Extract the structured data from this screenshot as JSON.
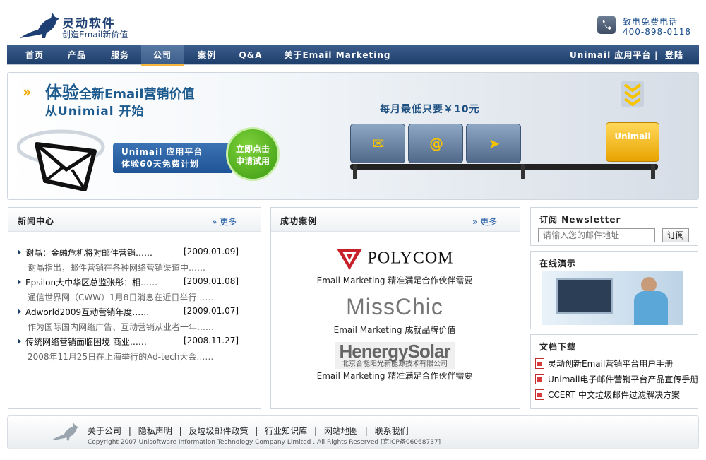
{
  "header": {
    "brand_name": "灵动软件",
    "slogan": "创造Email新价值",
    "phone_label": "致电免费电话",
    "phone_number": "400-898-0118"
  },
  "nav": {
    "items": [
      "首页",
      "产品",
      "服务",
      "公司",
      "案例",
      "Q&A",
      "关于Email Marketing"
    ],
    "active": "公司",
    "right_platform": "Unimail 应用平台",
    "right_sep": "|",
    "right_login": "登陆"
  },
  "banner": {
    "title_big": "体验",
    "title_rest": "全新Email营销价值",
    "subtitle": "从Unimial 开始",
    "promo_line1": "Unimail 应用平台",
    "promo_line2": "体验60天免费计划",
    "cta_line1": "立即点击",
    "cta_line2": "申请试用",
    "price_text": "每月最低只要￥10元",
    "gold_seat_label": "Unimail"
  },
  "news": {
    "title": "新闻中心",
    "more": "更多",
    "items": [
      {
        "title": "谢晶：金融危机将对邮件营销……",
        "date": "[2009.01.09]",
        "desc": "谢晶指出，邮件营销在各种网络营销渠道中……"
      },
      {
        "title": "Epsilon大中华区总监张彤：相……",
        "date": "[2009.01.08]",
        "desc": "通信世界网（CWW）1月8日消息在近日举行……"
      },
      {
        "title": "Adworld2009互动营销年度……",
        "date": "[2009.01.07]",
        "desc": "作为国际国内网络广告、互动营销从业者一年……"
      },
      {
        "title": "传统网络营销面临困境 商业……",
        "date": "[2008.11.27]",
        "desc": "2008年11月25日在上海举行的Ad-tech大会……"
      }
    ]
  },
  "cases": {
    "title": "成功案例",
    "more": "更多",
    "items": [
      {
        "logo": "POLYCOM",
        "caption": "Email Marketing 精准满足合作伙伴需要"
      },
      {
        "logo": "MissChic",
        "caption": "Email Marketing 成就品牌价值"
      },
      {
        "logo": "HenergySolar",
        "logo_sub": "北京合能阳光新能源技术有限公司",
        "caption": "Email Marketing 精准满足合作伙伴需要"
      }
    ]
  },
  "newsletter": {
    "title": "订阅 Newsletter",
    "placeholder": "请输入您的邮件地址",
    "button": "订阅"
  },
  "demo": {
    "title": "在线演示"
  },
  "docs": {
    "title": "文档下载",
    "items": [
      "灵动创新Email营销平台用户手册",
      "Unimail电子邮件营销平台产品宣传手册",
      "CCERT 中文垃圾邮件过滤解决方案"
    ]
  },
  "footer": {
    "links": [
      "关于公司",
      "隐私声明",
      "反垃圾邮件政策",
      "行业知识库",
      "网站地图",
      "联系我们"
    ],
    "sep": "|",
    "copyright": "Copyright 2007 Unisoftware Information Technology Company Limited , All Rights Reserved [京ICP备06068737]"
  },
  "colors": {
    "nav_bg": "#1f3f6b",
    "brand_blue": "#1d5b8f",
    "accent_gold": "#f0a800",
    "cta_green": "#3a9a12",
    "link_blue": "#2760a8"
  }
}
